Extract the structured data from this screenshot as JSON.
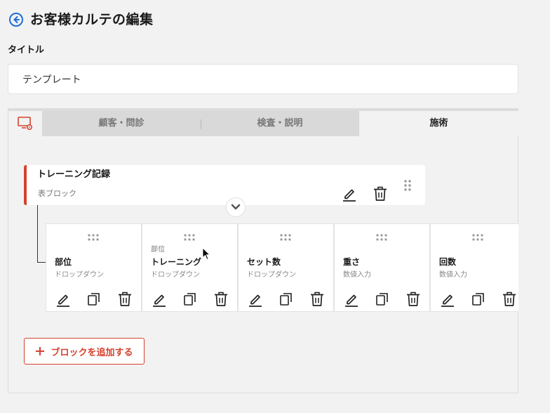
{
  "header": {
    "title": "お客様カルテの編集",
    "back_icon": "arrow-left-circle-icon"
  },
  "title_field": {
    "label": "タイトル",
    "value": "テンプレート"
  },
  "tabs": {
    "settings_icon": "screen-gear-icon",
    "items": [
      {
        "label": "顧客・問診",
        "active": false
      },
      {
        "label": "検査・説明",
        "active": false
      },
      {
        "label": "施術",
        "active": true
      }
    ]
  },
  "block": {
    "title": "トレーニング記録",
    "type": "表ブロック",
    "accent_color": "#d5412e"
  },
  "columns": [
    {
      "prefix": "",
      "name": "部位",
      "type": "ドロップダウン"
    },
    {
      "prefix": "部位",
      "name": "トレーニング",
      "type": "ドロップダウン"
    },
    {
      "prefix": "",
      "name": "セット数",
      "type": "ドロップダウン"
    },
    {
      "prefix": "",
      "name": "重さ",
      "type": "数値入力"
    },
    {
      "prefix": "",
      "name": "回数",
      "type": "数値入力"
    }
  ],
  "add_block": {
    "label": "ブロックを追加する"
  }
}
